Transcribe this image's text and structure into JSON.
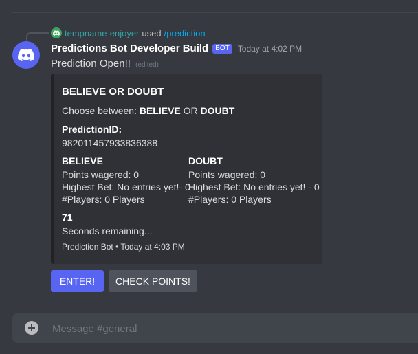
{
  "interaction": {
    "username": "tempname-enjoyer",
    "used_text": "used",
    "command": "/prediction"
  },
  "message": {
    "author": "Predictions Bot Developer Build",
    "bot_tag": "BOT",
    "timestamp": "Today at 4:02 PM",
    "content": "Prediction Open!!",
    "edited": "(edited)"
  },
  "embed": {
    "title": "BELIEVE OR DOUBT",
    "description": {
      "prefix": "Choose between: ",
      "option_a": "BELIEVE",
      "or": "OR",
      "option_b": "DOUBT"
    },
    "prediction_id": {
      "name": "PredictionID:",
      "value": "982011457933836388"
    },
    "believe": {
      "name": "BELIEVE",
      "points": "Points wagered: 0",
      "highest": "Highest Bet: No entries yet!- 0",
      "players": "#Players: 0 Players"
    },
    "doubt": {
      "name": "DOUBT",
      "points": "Points wagered: 0",
      "highest": "Highest Bet: No entries yet! - 0",
      "players": "#Players: 0 Players"
    },
    "countdown": {
      "name": "71",
      "value": "Seconds remaining..."
    },
    "footer": "Prediction Bot • Today at 4:03 PM"
  },
  "buttons": {
    "enter": "ENTER!",
    "check_points": "CHECK POINTS!"
  },
  "composer": {
    "placeholder": "Message #general"
  },
  "colors": {
    "background": "#36393f",
    "embed_bg": "#2f3136",
    "blurple": "#5865f2",
    "secondary_button": "#4f545c",
    "command_link": "#00aff4"
  }
}
